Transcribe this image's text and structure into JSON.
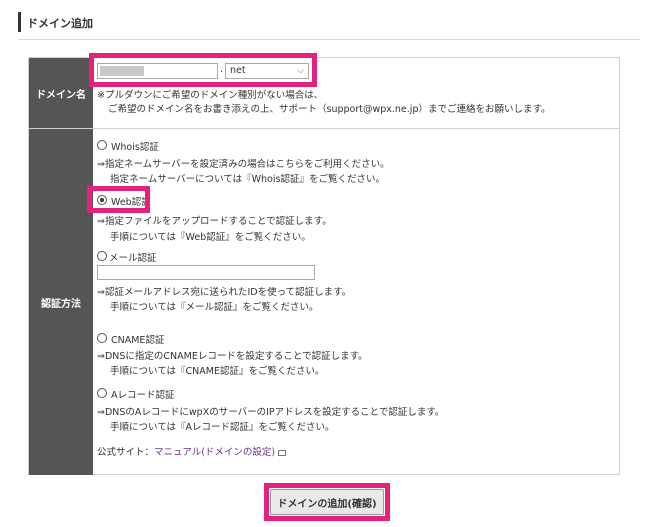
{
  "header": {
    "title": "ドメイン追加"
  },
  "domain_row": {
    "label": "ドメイン名",
    "domain_value": "",
    "dot": ".",
    "tld_selected": "net",
    "note_line1": "※プルダウンにご希望のドメイン種別がない場合は、",
    "note_line2": "ご希望のドメイン名をお書き添えの上、サポート（support@wpx.ne.jp）までご連絡をお願いします。"
  },
  "auth_row": {
    "label": "認証方法",
    "options": [
      {
        "label": "Whois認証",
        "selected": false,
        "desc1": "⇒指定ネームサーバーを設定済みの場合はこちらをご利用ください。",
        "desc2": "指定ネームサーバーについては『Whois認証』をご覧ください。"
      },
      {
        "label": "Web認証",
        "selected": true,
        "desc1": "⇒指定ファイルをアップロードすることで認証します。",
        "desc2": "手順については『Web認証』をご覧ください。"
      },
      {
        "label": "メール認証",
        "selected": false,
        "desc1": "⇒認証メールアドレス宛に送られたIDを使って認証します。",
        "desc2": "手順については『メール認証』をご覧ください。"
      },
      {
        "label": "CNAME認証",
        "selected": false,
        "desc1": "⇒DNSに指定のCNAMEレコードを設定することで認証します。",
        "desc2": "手順については『CNAME認証』をご覧ください。"
      },
      {
        "label": "Aレコード認証",
        "selected": false,
        "desc1": "⇒DNSのAレコードにwpXのサーバーのIPアドレスを設定することで認証します。",
        "desc2": "手順については『Aレコード認証』をご覧ください。"
      }
    ],
    "mail_input_value": "",
    "official_prefix": "公式サイト：",
    "official_link": "マニュアル(ドメインの設定)"
  },
  "submit": {
    "label": "ドメインの追加(確認)"
  },
  "colors": {
    "highlight": "#e6207f",
    "row_head_bg": "#555555",
    "link": "#6b2f8f"
  }
}
